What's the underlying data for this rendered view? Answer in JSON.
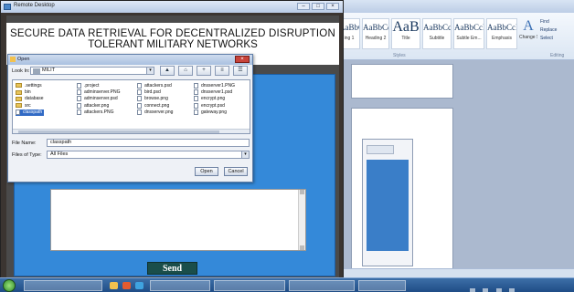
{
  "rdp": {
    "title": "Remote Desktop"
  },
  "app": {
    "title_line1": "SECURE DATA RETRIEVAL FOR DECENTRALIZED DISRUPTION",
    "title_line2": "TOLERANT MILITARY NETWORKS",
    "send_label": "Send"
  },
  "dialog": {
    "title": "Open",
    "look_in_label": "Look In:",
    "look_in_value": "MILIT",
    "files": [
      {
        "name": ".settings",
        "type": "folder"
      },
      {
        "name": "bin",
        "type": "folder"
      },
      {
        "name": "database",
        "type": "folder"
      },
      {
        "name": "src",
        "type": "folder"
      },
      {
        "name": "classpath",
        "type": "file",
        "selected": true
      },
      {
        "name": ".project",
        "type": "file"
      },
      {
        "name": "adminserver.PNG",
        "type": "file"
      },
      {
        "name": "adminserver.psd",
        "type": "file"
      },
      {
        "name": "attacker.png",
        "type": "file"
      },
      {
        "name": "attackers.PNG",
        "type": "file"
      },
      {
        "name": "attackers.psd",
        "type": "file"
      },
      {
        "name": "bird.psd",
        "type": "file"
      },
      {
        "name": "browse.png",
        "type": "file"
      },
      {
        "name": "connect.png",
        "type": "file"
      },
      {
        "name": "dnsserver.png",
        "type": "file"
      },
      {
        "name": "dnsserver1.PNG",
        "type": "file"
      },
      {
        "name": "dnsserver1.psd",
        "type": "file"
      },
      {
        "name": "encrypt.png",
        "type": "file"
      },
      {
        "name": "encrypt.psd",
        "type": "file"
      },
      {
        "name": "gateway.png",
        "type": "file"
      }
    ],
    "file_name_label": "File Name:",
    "file_name_value": "classpath",
    "file_type_label": "Files of Type:",
    "file_type_value": "All Files",
    "open_label": "Open",
    "cancel_label": "Cancel"
  },
  "word": {
    "styles": [
      {
        "sample": "AaBbC",
        "name": "ing 1"
      },
      {
        "sample": "AaBbCc",
        "name": "Heading 2"
      },
      {
        "sample": "AaB",
        "name": "Title"
      },
      {
        "sample": "AaBbCc",
        "name": "Subtitle"
      },
      {
        "sample": "AaBbCcDd",
        "name": "Subtle Em..."
      },
      {
        "sample": "AaBbCcDd",
        "name": "Emphasis"
      }
    ],
    "change_styles_label": "Change Styles",
    "find_label": "Find",
    "replace_label": "Replace",
    "select_label": "Select",
    "styles_group_label": "Styles",
    "editing_group_label": "Editing"
  },
  "colors": {
    "app_blue": "#3489d9",
    "send_bg": "#1a4e4a",
    "taskbar": "#1f4d86"
  }
}
